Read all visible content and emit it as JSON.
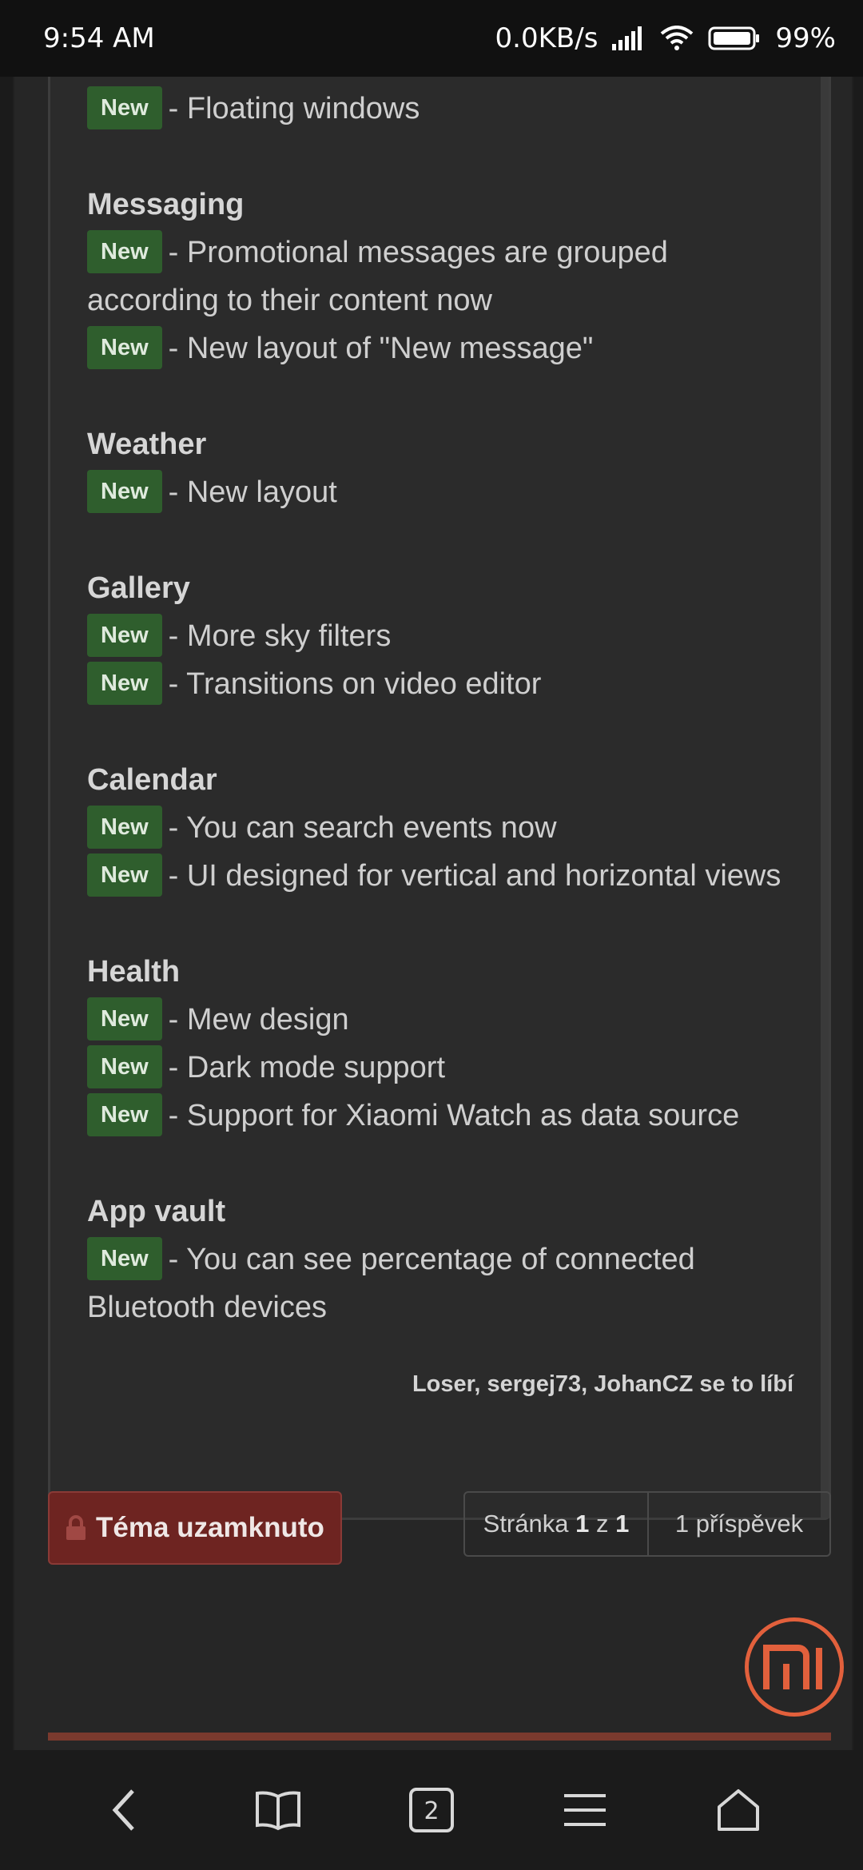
{
  "status": {
    "time": "9:54 AM",
    "speed": "0.0KB/s",
    "battery": "99%"
  },
  "post": {
    "first_item": "- Floating windows",
    "sections": [
      {
        "heading": "Messaging",
        "items": [
          "- Promotional messages are grouped according to their content now",
          "- New layout of \"New message\""
        ]
      },
      {
        "heading": "Weather",
        "items": [
          "- New layout"
        ]
      },
      {
        "heading": "Gallery",
        "items": [
          "- More sky filters",
          "- Transitions on video editor"
        ]
      },
      {
        "heading": "Calendar",
        "items": [
          "- You can search events now",
          "- UI designed for vertical and horizontal views"
        ]
      },
      {
        "heading": "Health",
        "items": [
          "- Mew design",
          "- Dark mode support",
          "- Support for Xiaomi Watch as data source"
        ]
      },
      {
        "heading": "App vault",
        "items": [
          "- You can see percentage of connected Bluetooth devices"
        ]
      }
    ],
    "badge_label": "New",
    "likes": "Loser, sergej73, JohanCZ se to líbí"
  },
  "controls": {
    "locked_label": "Téma uzamknuto",
    "page_prefix": "Stránka",
    "page_current": "1",
    "page_of": "z",
    "page_total": "1",
    "post_count": "1 příspěvek"
  },
  "nav": {
    "tabs_count": "2"
  },
  "colors": {
    "badge_bg": "#2f5e2d",
    "locked_bg": "#6e2421",
    "mi_orange": "#e2603c"
  },
  "icons": [
    "wifi-icon",
    "signal-icon",
    "battery-icon",
    "lock-icon",
    "mi-logo",
    "back-icon",
    "bookmarks-icon",
    "tabs-icon",
    "menu-icon",
    "home-icon"
  ]
}
